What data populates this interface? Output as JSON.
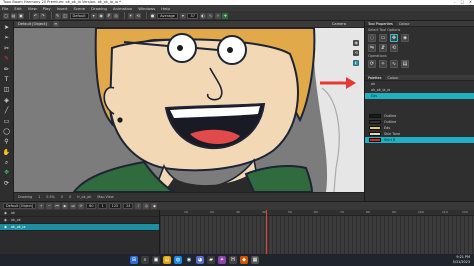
{
  "window": {
    "title": "Toon Boom Harmony 20 Premium: ok_ok_ia Version: ok_ok_ia_ia *"
  },
  "menu": [
    "File",
    "Edit",
    "View",
    "Play",
    "Insert",
    "Scene",
    "Drawing",
    "Animation",
    "Windows",
    "Help"
  ],
  "toolbar": {
    "layer_select": "Default",
    "blend_select": "Average",
    "size_value": "37"
  },
  "view": {
    "tab_label": "Default [Object]",
    "title": "Camera",
    "footer": [
      "Drawing",
      "1",
      "0.5%",
      "0",
      "0",
      "fr_ok_ok",
      "Map View"
    ]
  },
  "right_panel": {
    "tabs": [
      "Tool Properties",
      "Colour"
    ],
    "sections": [
      "Select Tool Options",
      "Operations"
    ],
    "palette_tabs": [
      "Palettes",
      "Colour"
    ],
    "palettes": [
      "ok",
      "ok_ok_ia_ia",
      "Eds"
    ],
    "colors": [
      {
        "name": "Outline",
        "hex": "#1a1a1a"
      },
      {
        "name": "Outline",
        "hex": "#333333"
      },
      {
        "name": "Eds",
        "hex": "#e8c56a"
      },
      {
        "name": "Skin Tone",
        "hex": "#f2d3b1"
      },
      {
        "name": "Shirt B",
        "hex": "#d02a2a"
      }
    ]
  },
  "timeline": {
    "layer_field": "Default [Object]",
    "frame": "60",
    "start": "1",
    "stop": "125",
    "fps": "24",
    "layers": [
      "ok",
      "ok_ok",
      "ok_ok_ia"
    ],
    "ruler": [
      "10",
      "20",
      "30",
      "40",
      "50",
      "60",
      "70",
      "80",
      "90",
      "100",
      "110",
      "120"
    ]
  },
  "taskbar": {
    "time": "9:21 PM",
    "date": "5/31/2023"
  },
  "colors": {
    "accent": "#1fb0c4",
    "highlight": "#e53935",
    "outline": "#1c2436",
    "hair": "#e2a94a",
    "skin": "#f3d8b5",
    "jacket": "#2f6b3c"
  }
}
